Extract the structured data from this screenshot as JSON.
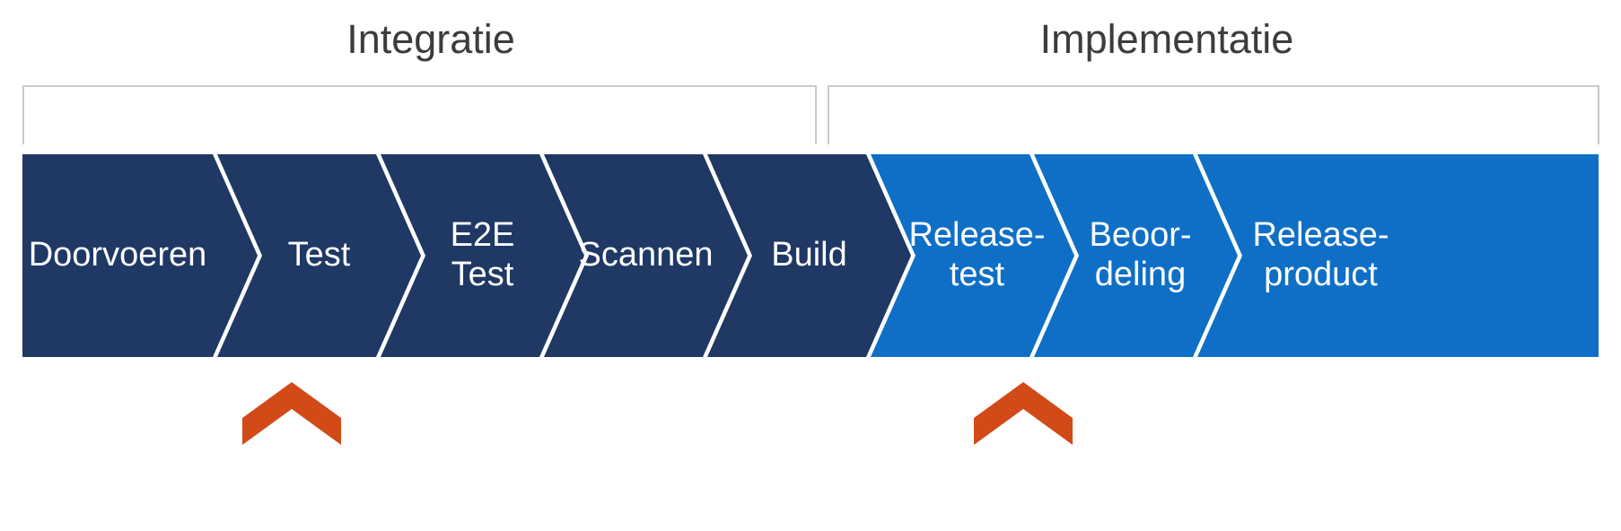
{
  "colors": {
    "integration": "#1f3864",
    "implementation": "#0f6fc6",
    "marker": "#d24a17",
    "bracket": "#c9c9c9",
    "label": "#3c3c3c"
  },
  "phases": {
    "integration": {
      "label": "Integratie"
    },
    "implementation": {
      "label": "Implementatie"
    }
  },
  "steps": [
    {
      "label": "Doorvoeren",
      "group": "integration"
    },
    {
      "label": "Test",
      "group": "integration"
    },
    {
      "label": "E2E\nTest",
      "group": "integration"
    },
    {
      "label": "Scannen",
      "group": "integration"
    },
    {
      "label": "Build",
      "group": "integration"
    },
    {
      "label": "Release-\ntest",
      "group": "implementation"
    },
    {
      "label": "Beoor-\ndeling",
      "group": "implementation"
    },
    {
      "label": "Release-\nproduct",
      "group": "implementation"
    }
  ],
  "markers": [
    {
      "below_step_index": 1
    },
    {
      "below_step_index": 5
    }
  ]
}
